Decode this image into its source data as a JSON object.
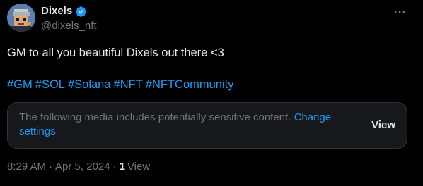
{
  "author": {
    "display_name": "Dixels",
    "handle": "@dixels_nft",
    "avatar_icon": "pixel-character-avatar",
    "verified_icon": "verified-badge-icon"
  },
  "menu": {
    "icon": "more-horizontal-icon"
  },
  "tweet": {
    "text": "GM to all you beautiful Dixels out there <3",
    "hashtags": [
      "#GM",
      "#SOL",
      "#Solana",
      "#NFT",
      "#NFTCommunity"
    ]
  },
  "sensitive": {
    "message": "The following media includes potentially sensitive content.",
    "link_text": "Change settings",
    "view_label": "View"
  },
  "meta": {
    "time": "8:29 AM",
    "date": "Apr 5, 2024",
    "separator": "·",
    "view_count": "1",
    "view_label": "View"
  },
  "colors": {
    "background": "#000000",
    "text_primary": "#e7e9ea",
    "text_secondary": "#71767b",
    "accent": "#1d9bf0",
    "card_bg": "#16181c",
    "border": "#2f3336"
  }
}
